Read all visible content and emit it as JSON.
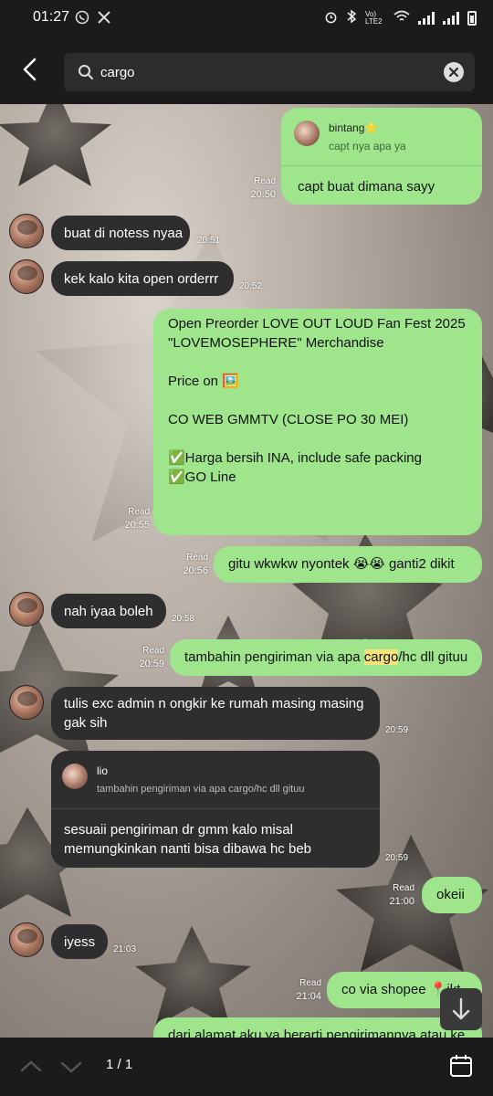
{
  "status": {
    "time": "01:27",
    "left_icons": [
      "whatsapp-icon",
      "x-icon"
    ],
    "right_icons": [
      "alarm-icon",
      "bluetooth-icon",
      "volte-icon",
      "wifi-icon",
      "signal-icon",
      "signal-icon",
      "battery-icon"
    ],
    "volte_label": "Vo) LTE2"
  },
  "header": {
    "search_value": "cargo",
    "back_icon": "arrow-left-icon",
    "search_icon": "search-icon",
    "clear_icon": "close-icon"
  },
  "messages": [
    {
      "dir": "out",
      "quote_name": "bintang⭐",
      "quote_text": "capt nya apa ya",
      "text": "capt buat dimana sayy",
      "read": "Read",
      "time": "20:50"
    },
    {
      "dir": "in",
      "text": "buat di notess nyaa",
      "time": "20:51"
    },
    {
      "dir": "in",
      "text": "kek kalo kita open orderrr",
      "time": "20:52"
    },
    {
      "dir": "out",
      "lines": [
        "Open Preorder LOVE OUT LOUD Fan Fest 2025",
        "\"LOVEMOSEPHERE\" Merchandise",
        "",
        "Price on 🖼️",
        "",
        "CO WEB GMMTV (CLOSE PO 30 MEI)",
        "",
        "✅Harga bersih INA, include safe packing",
        "✅GO Line"
      ],
      "read": "Read",
      "time": "20:55"
    },
    {
      "dir": "out",
      "text": "gitu wkwkw nyontek 😭😭 ganti2 dikit",
      "read": "Read",
      "time": "20:56"
    },
    {
      "dir": "in",
      "text": "nah iyaa boleh",
      "time": "20:58"
    },
    {
      "dir": "out",
      "text_before": "tambahin pengiriman via apa ",
      "text_highlight": "cargo",
      "text_after": "/hc dll gituu",
      "read": "Read",
      "time": "20:59"
    },
    {
      "dir": "in",
      "lines": [
        "tulis exc admin n ongkir ke rumah masing masing",
        "gak sih"
      ],
      "time": "20:59"
    },
    {
      "dir": "in",
      "quote_name": "lio",
      "quote_text": "tambahin pengiriman via apa cargo/hc dll gituu",
      "lines": [
        "sesuaii pengiriman dr gmm kalo misal",
        "memungkinkan nanti bisa dibawa hc beb"
      ],
      "time": "20:59"
    },
    {
      "dir": "out",
      "text": "okeii",
      "read": "Read",
      "time": "21:00"
    },
    {
      "dir": "in",
      "text": "iyess",
      "time": "21:03"
    },
    {
      "dir": "out",
      "text": "co via shopee 📍ikt",
      "read": "Read",
      "time": "21:04"
    },
    {
      "dir": "out",
      "text": "dari alamat aku ya berarti pengirimannya atau ke"
    }
  ],
  "footer": {
    "page_count": "1 / 1",
    "up_icon": "chevron-up-icon",
    "down_icon": "chevron-down-icon",
    "calendar_icon": "calendar-icon",
    "scroll_icon": "arrow-down-icon"
  }
}
